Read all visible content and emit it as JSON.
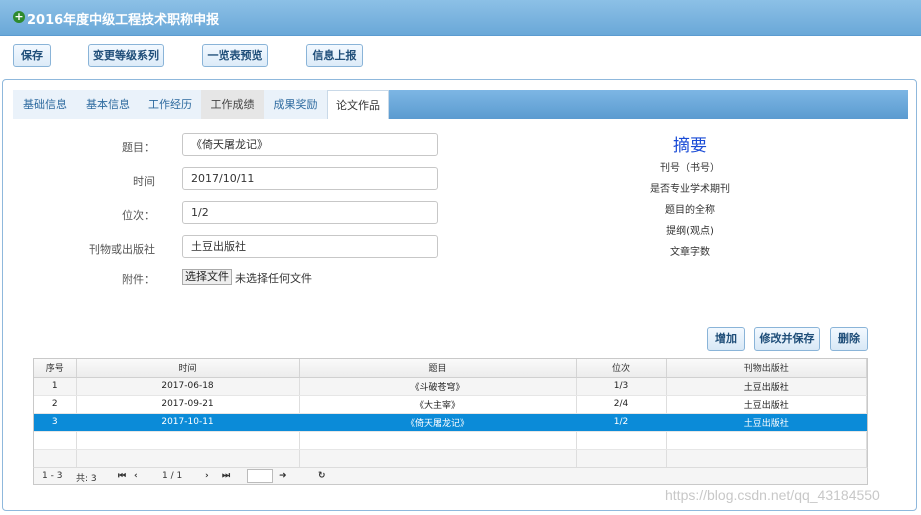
{
  "window": {
    "title": "2016年度中级工程技术职称申报"
  },
  "toolbar": {
    "save": "保存",
    "change_level": "变更等级系列",
    "preview": "一览表预览",
    "submit": "信息上报"
  },
  "tabs": [
    "基础信息",
    "基本信息",
    "工作经历",
    "工作成绩",
    "成果奖励",
    "论文作品"
  ],
  "form": {
    "title_label": "题目：",
    "title_value": "《倚天屠龙记》",
    "time_label": "时间",
    "time_value": "2017/10/11",
    "rank_label": "位次：",
    "rank_value": "1/2",
    "publisher_label": "刊物或出版社",
    "publisher_value": "土豆出版社",
    "attach_label": "附件：",
    "file_button": "选择文件",
    "file_status": "未选择任何文件"
  },
  "summary": {
    "heading": "摘要",
    "lines": [
      "刊号（书号）",
      "是否专业学术期刊",
      "题目的全称",
      "提纲(观点)",
      "文章字数"
    ]
  },
  "actions": {
    "add": "增加",
    "modify_save": "修改并保存",
    "delete": "删除"
  },
  "table": {
    "headers": [
      "序号",
      "时间",
      "题目",
      "位次",
      "刊物出版社"
    ],
    "rows": [
      [
        "1",
        "2017-06-18",
        "《斗破苍穹》",
        "1/3",
        "土豆出版社"
      ],
      [
        "2",
        "2017-09-21",
        "《大主宰》",
        "2/4",
        "土豆出版社"
      ],
      [
        "3",
        "2017-10-11",
        "《倚天屠龙记》",
        "1/2",
        "土豆出版社"
      ]
    ],
    "selected_row": 3
  },
  "pager": {
    "range": "1 - 3",
    "total": "共: 3",
    "page": "1 / 1"
  },
  "watermark": "https://blog.csdn.net/qq_43184550"
}
